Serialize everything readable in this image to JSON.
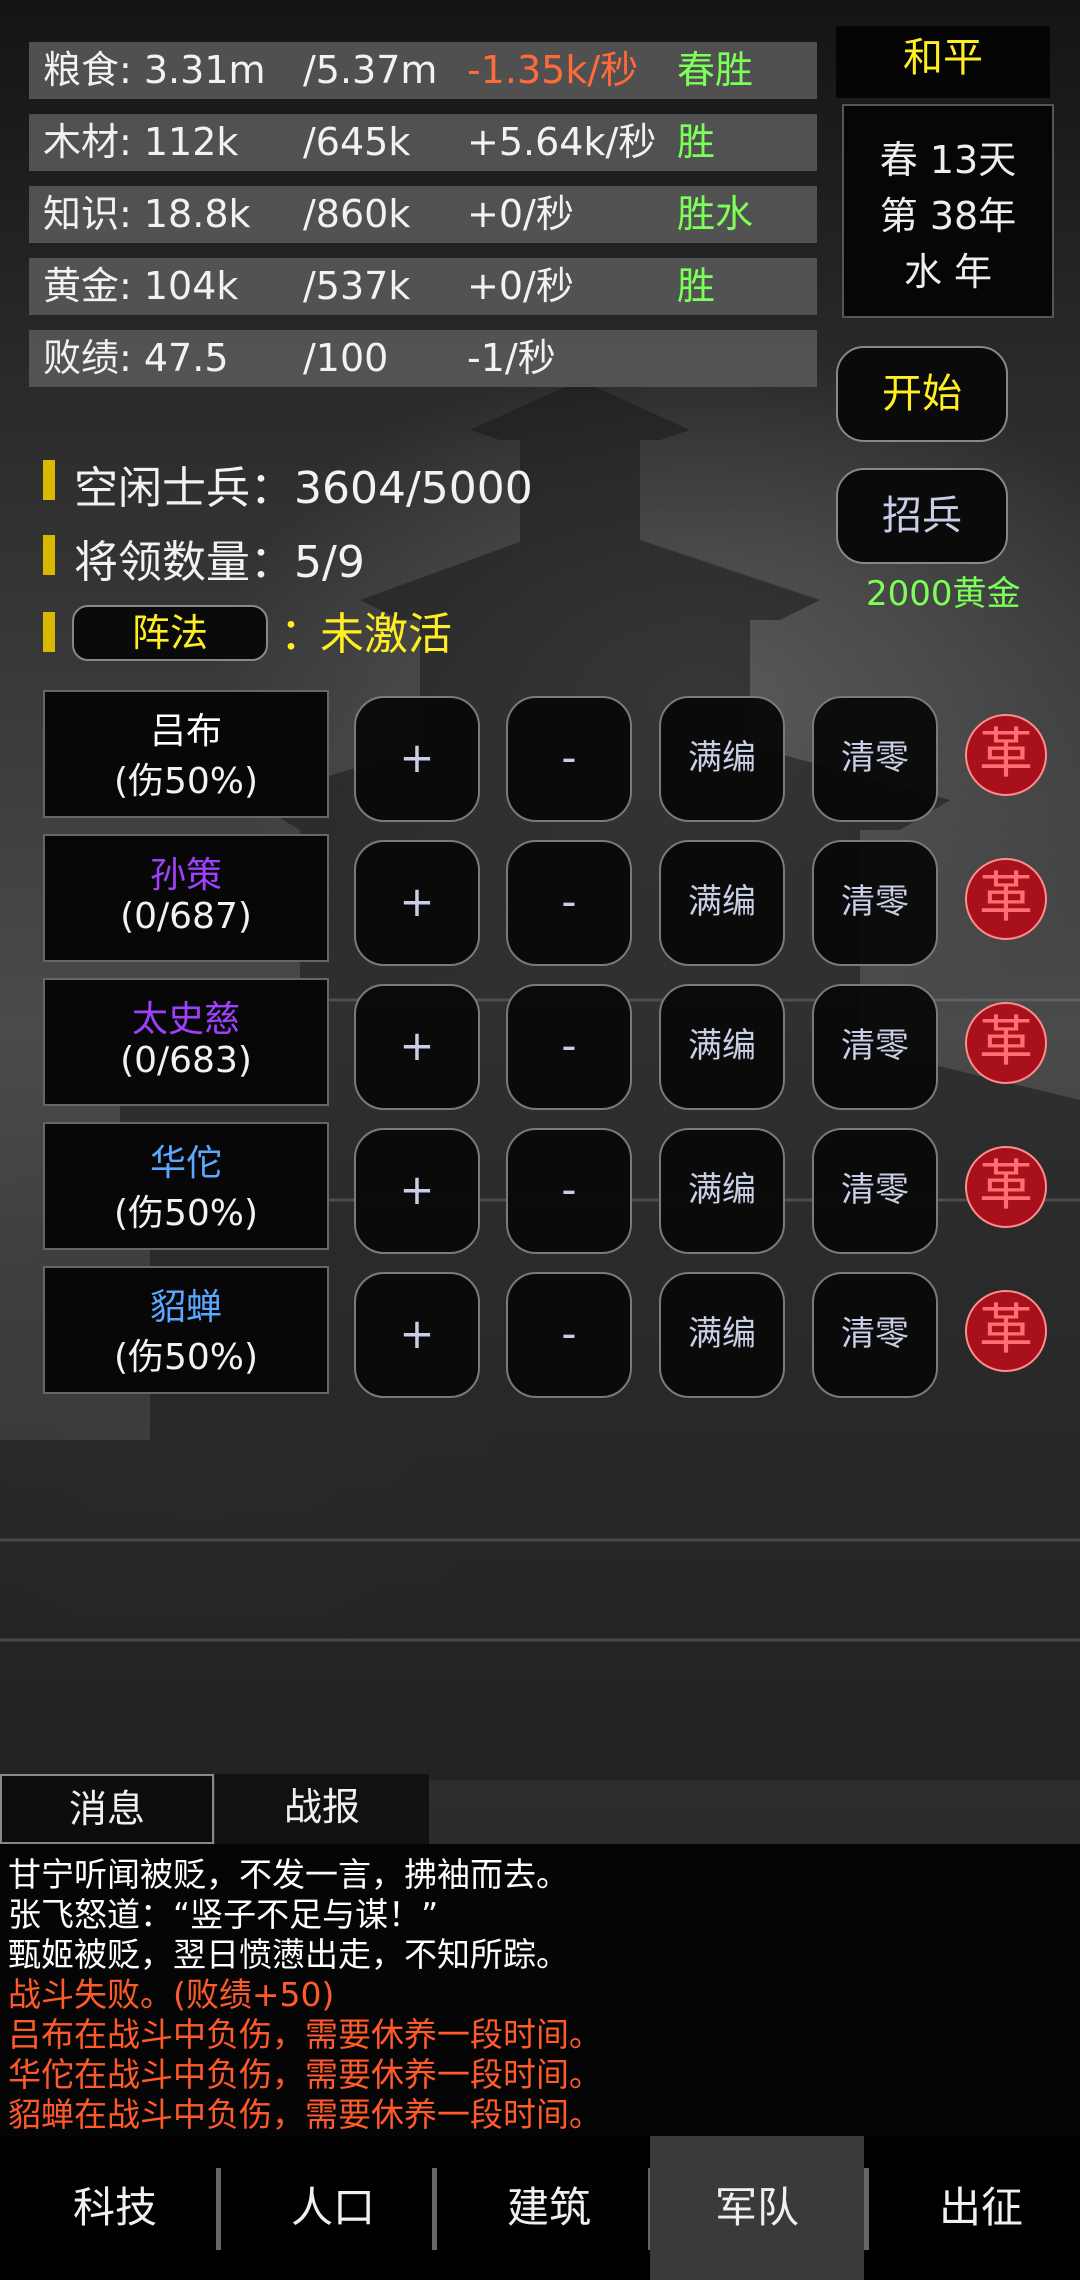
{
  "resources": [
    {
      "name": "粮食: 3.31m",
      "cap": "/5.37m",
      "rate": "-1.35k/秒",
      "tag": "春胜",
      "negative": true
    },
    {
      "name": "木材: 112k",
      "cap": "/645k",
      "rate": "+5.64k/秒",
      "tag": "胜",
      "negative": false
    },
    {
      "name": "知识: 18.8k",
      "cap": "/860k",
      "rate": "+0/秒",
      "tag": "胜水",
      "negative": false
    },
    {
      "name": "黄金: 104k",
      "cap": "/537k",
      "rate": "+0/秒",
      "tag": "胜",
      "negative": false
    },
    {
      "name": "败绩: 47.5",
      "cap": "/100",
      "rate": "-1/秒",
      "tag": "",
      "negative": false
    }
  ],
  "status": {
    "peace": "和平",
    "date_line1": "春 13天",
    "date_line2": "第 38年",
    "date_line3": "水 年"
  },
  "buttons": {
    "start": "开始",
    "recruit": "招兵",
    "recruit_cost": "2000黄金"
  },
  "army": {
    "idle_soldiers": "空闲士兵：3604/5000",
    "general_count": "将领数量：5/9",
    "formation_label": "阵法",
    "formation_colon": "：",
    "formation_status": "未激活"
  },
  "generals": [
    {
      "name": "吕布",
      "status": "(伤50%)",
      "color": "#ffffff"
    },
    {
      "name": "孙策",
      "status": "(0/687)",
      "color": "#a040ff"
    },
    {
      "name": "太史慈",
      "status": "(0/683)",
      "color": "#a040ff"
    },
    {
      "name": "华佗",
      "status": "(伤50%)",
      "color": "#5aa8ff"
    },
    {
      "name": "貂蝉",
      "status": "(伤50%)",
      "color": "#5aa8ff"
    }
  ],
  "general_actions": {
    "add": "+",
    "remove": "-",
    "fill": "满编",
    "clear": "清零",
    "dismiss": "革"
  },
  "tabs": {
    "messages": "消息",
    "battle_report": "战报"
  },
  "log": [
    {
      "text": "甘宁听闻被贬，不发一言，拂袖而去。",
      "color": "#ffffff"
    },
    {
      "text": "张飞怒道：“竖子不足与谋！”",
      "color": "#ffffff"
    },
    {
      "text": "甄姬被贬，翌日愤懑出走，不知所踪。",
      "color": "#ffffff"
    },
    {
      "text": "战斗失败。(败绩+50)",
      "color": "#ff5a2a"
    },
    {
      "text": "吕布在战斗中负伤，需要休养一段时间。",
      "color": "#ff5a2a"
    },
    {
      "text": "华佗在战斗中负伤，需要休养一段时间。",
      "color": "#ff5a2a"
    },
    {
      "text": "貂蝉在战斗中负伤，需要休养一段时间。",
      "color": "#ff5a2a"
    }
  ],
  "nav": [
    {
      "label": "科技",
      "active": false
    },
    {
      "label": "人口",
      "active": false
    },
    {
      "label": "建筑",
      "active": false
    },
    {
      "label": "军队",
      "active": true
    },
    {
      "label": "出征",
      "active": false
    }
  ]
}
